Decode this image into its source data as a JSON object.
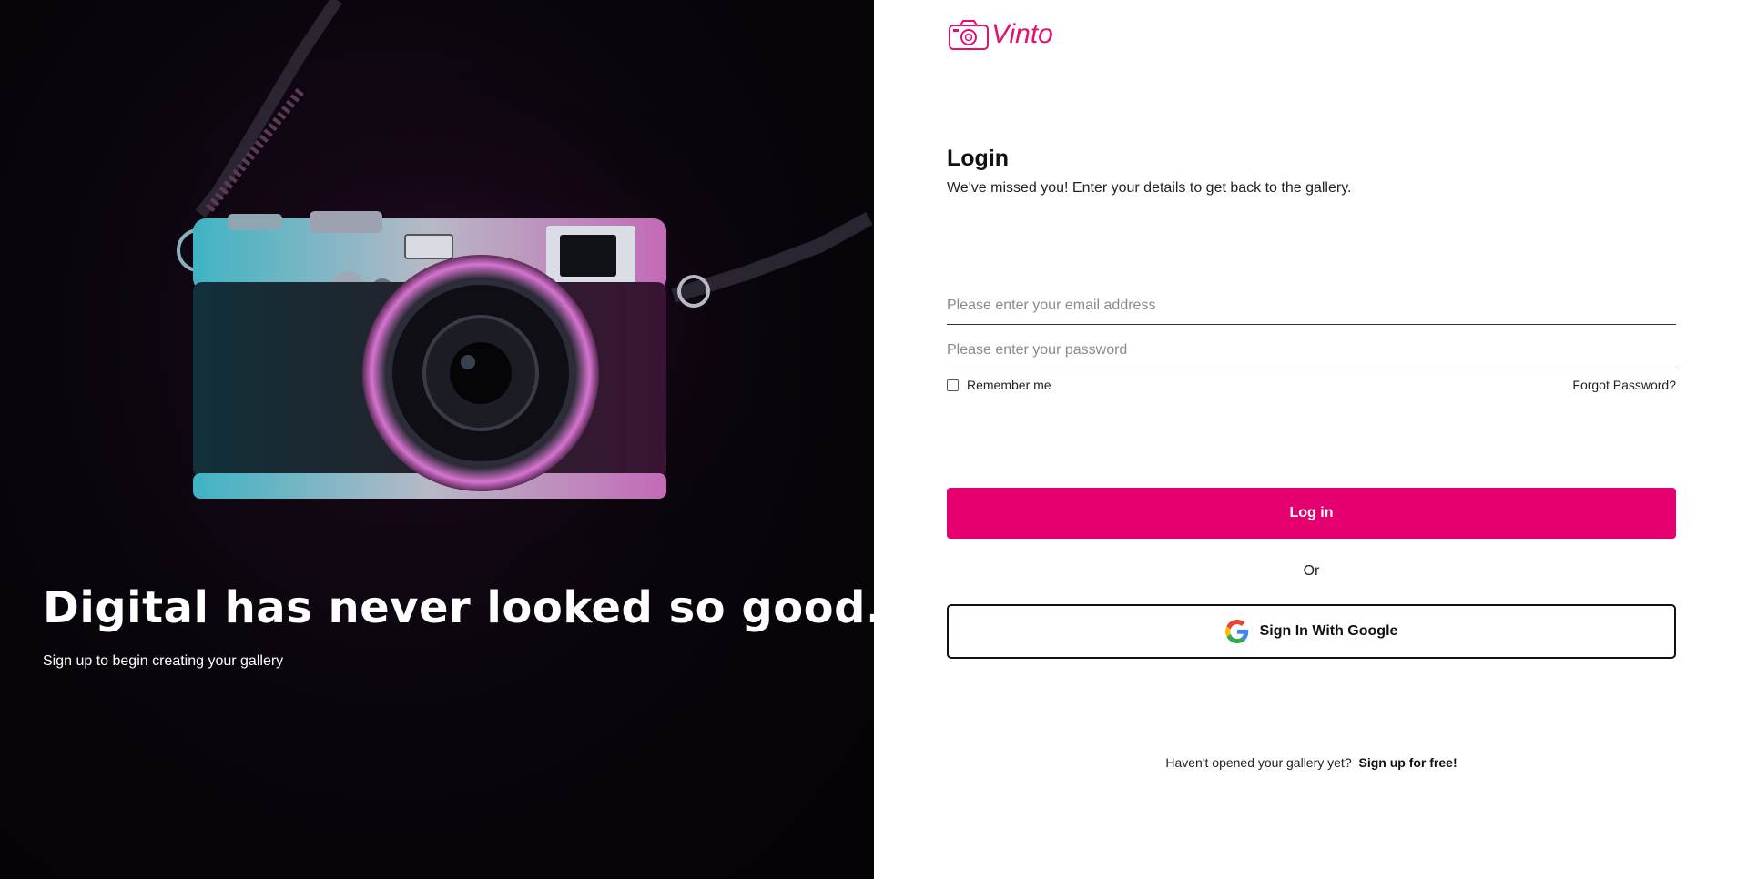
{
  "brand": {
    "name": "Vinto",
    "color": "#e0116f"
  },
  "hero": {
    "headline": "Digital has never looked so good.",
    "subtext": "Sign up to begin creating your gallery",
    "image": "camera-photo"
  },
  "login": {
    "title": "Login",
    "subtitle": "We've missed you! Enter your details to get back to the gallery.",
    "email_placeholder": "Please enter your email address",
    "password_placeholder": "Please enter your password",
    "remember_label": "Remember me",
    "forgot_label": "Forgot Password?",
    "login_button": "Log in",
    "or_label": "Or",
    "google_button": "Sign In With Google",
    "signup_prompt": "Haven't opened your gallery yet?",
    "signup_link": "Sign up for free!"
  },
  "colors": {
    "accent": "#e6006f",
    "hero_bg": "#0b050d"
  }
}
